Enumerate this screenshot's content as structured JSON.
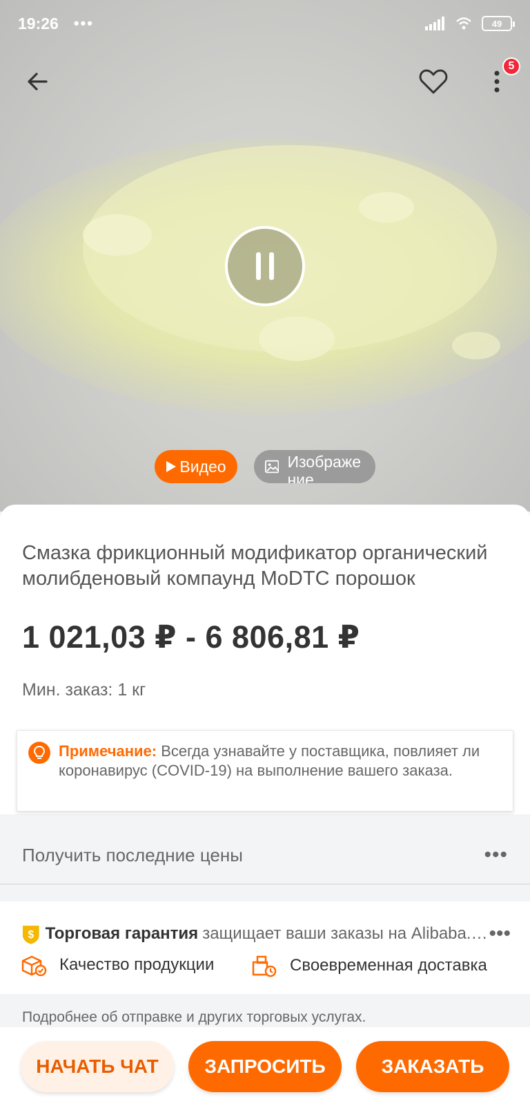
{
  "status_bar": {
    "time": "19:26",
    "dots": "•••",
    "battery": "49"
  },
  "header": {
    "badge_count": "5"
  },
  "media": {
    "video_tab": "Видео",
    "images_tab": "Изображение"
  },
  "product": {
    "title": "Смазка фрикционный модификатор органический молибденовый компаунд MoDTC порошок",
    "price": "1 021,03 ₽ - 6 806,81 ₽",
    "min_order": "Мин. заказ: 1 кг"
  },
  "note": {
    "label": "Примечание:",
    "text": " Всегда узнавайте у поставщика, повлияет ли коронавирус (COVID-19) на выполнение вашего заказа."
  },
  "prices_row": {
    "label": "Получить последние цены",
    "dots": "•••"
  },
  "trade_assurance": {
    "title": "Торговая гарантия",
    "description": "защищает ваши заказы на Alibaba.c...",
    "dots": "•••",
    "feature_quality": "Качество продукции",
    "feature_delivery": "Своевременная доставка"
  },
  "more_info": "Подробнее об отправке и других торговых услугах.",
  "bottom_bar": {
    "chat": "НАЧАТЬ ЧАТ",
    "request": "ЗАПРОСИТЬ",
    "order": "ЗАКАЗАТЬ"
  },
  "colors": {
    "accent": "#ff6a00",
    "badge": "#f2273b",
    "chat_bg": "#fff1e6"
  }
}
